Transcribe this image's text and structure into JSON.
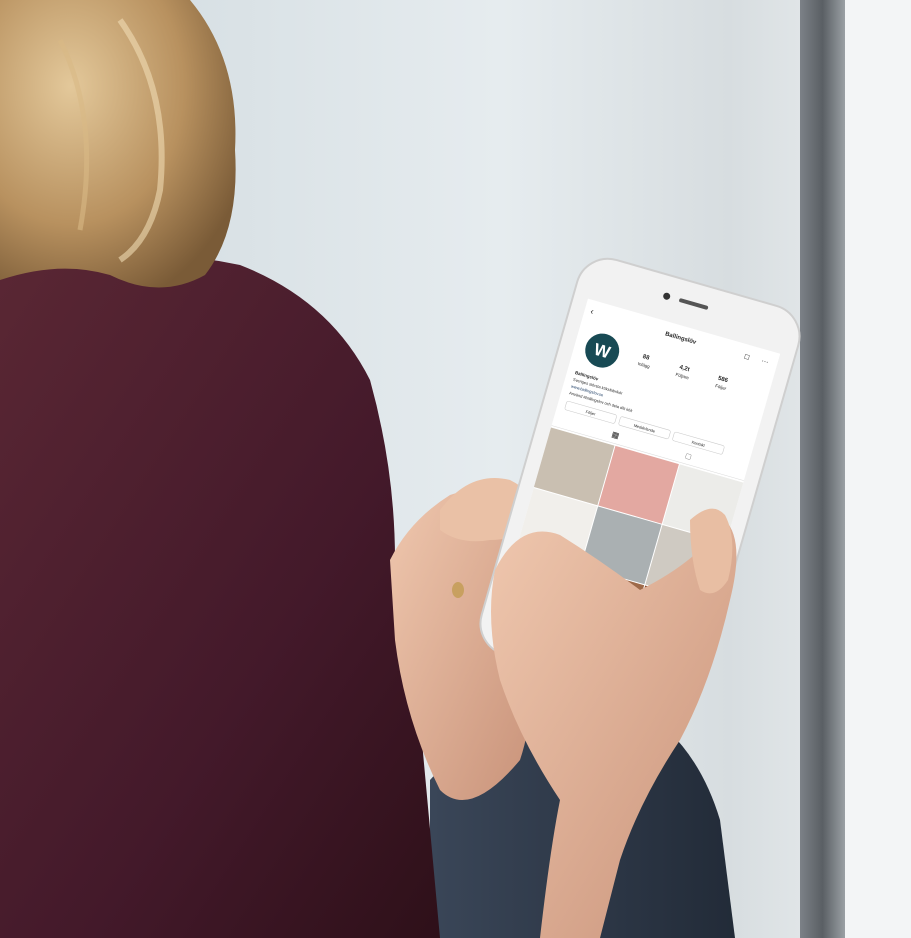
{
  "profile": {
    "username": "Ballingslöv",
    "posts_count": "88",
    "posts_label": "Inlägg",
    "followers_count": "4,2t",
    "followers_label": "Följare",
    "following_count": "586",
    "following_label": "Följer",
    "display_name": "Ballingslöv",
    "bio_lines": [
      "Sveriges största köksfabrikör",
      "www.ballingslov.se",
      "Använd #ballingslov och dela ditt kök"
    ]
  },
  "buttons": {
    "follow": "Följer",
    "message": "Meddelande",
    "contact": "Kontakt"
  },
  "tiles": [
    {
      "color": "#c9bfb1"
    },
    {
      "color": "#e3a8a1"
    },
    {
      "color": "#ecece9"
    },
    {
      "color": "#f1efeb"
    },
    {
      "color": "#aab0b2"
    },
    {
      "color": "#cfcac2"
    },
    {
      "color": "#5f8f9c"
    },
    {
      "color": "#9e6a4a"
    },
    {
      "color": "#8c4f35"
    }
  ],
  "colors": {
    "sweater": "#4a1f2b",
    "hair": "#b89160",
    "skin": "#e4b79e",
    "phone_body": "#eeeeee",
    "jeans": "#2e3a4a",
    "logo_circle": "#184a54"
  }
}
